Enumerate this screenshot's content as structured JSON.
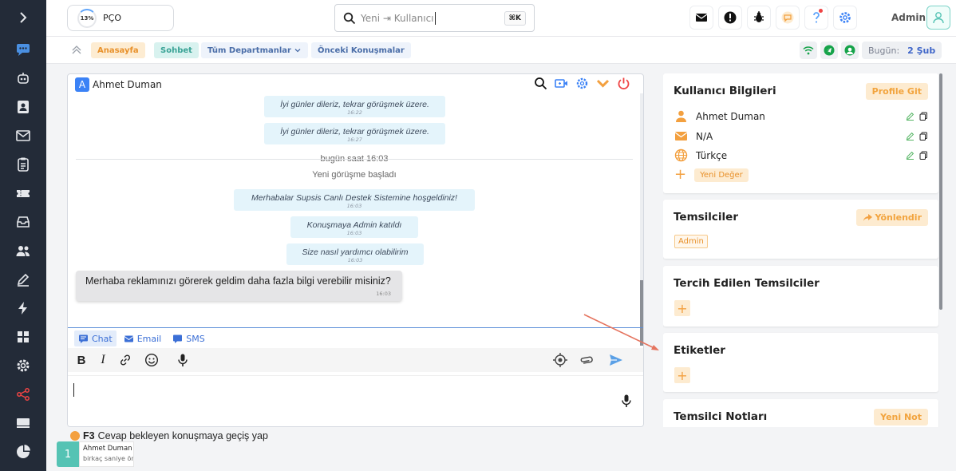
{
  "header": {
    "pco_percent": "13%",
    "pco_label": "PÇO",
    "search_placeholder": "Yeni ⇥ Kullanıcı",
    "shortcut": "⌘K",
    "admin_label": "Admin"
  },
  "sidebar": {
    "items": [
      "expand-icon",
      "chat-icon",
      "bot-icon",
      "contacts-icon",
      "mail-icon",
      "clipboard-icon",
      "ticket-icon",
      "inbox-icon",
      "users-icon",
      "edit-icon",
      "bolt-icon",
      "grid-icon",
      "settings-icon",
      "share-icon",
      "monitor-icon",
      "pie-icon"
    ]
  },
  "subbar": {
    "home": "Anasayfa",
    "chat": "Sohbet",
    "departments": "Tüm Departmanlar",
    "previous": "Önceki Konuşmalar",
    "today_label": "Bugün:",
    "today_value": "2 Şub"
  },
  "chat": {
    "contact_initial": "A",
    "contact_name": "Ahmet Duman",
    "messages": [
      {
        "text": "İyi günler dileriz, tekrar görüşmek üzere.",
        "time": "16:22"
      },
      {
        "text": "İyi günler dileriz, tekrar görüşmek üzere.",
        "time": "16:27"
      }
    ],
    "divider_text": "bugün saat 16:03",
    "session_text": "Yeni görüşme başladı",
    "system_messages": [
      {
        "text": "Merhabalar Supsis Canlı Destek Sistemine hoşgeldiniz!",
        "time": "16:03"
      },
      {
        "text": "Konuşmaya Admin katıldı",
        "time": "16:03"
      },
      {
        "text": "Size nasıl yardımcı olabilirim",
        "time": "16:03"
      }
    ],
    "incoming": {
      "text": "Merhaba reklamınızı görerek geldim daha fazla bilgi verebilir misiniz?",
      "time": "16:03"
    },
    "tabs": [
      "Chat",
      "Email",
      "SMS"
    ]
  },
  "footer": {
    "hint_key": "F3",
    "hint_text": "Cevap bekleyen konuşmaya geçiş yap",
    "queue_count": "1",
    "queue_name": "Ahmet Duman",
    "queue_time": "birkaç saniye önce"
  },
  "right": {
    "user_info": {
      "title": "Kullanıcı Bilgileri",
      "button": "Profile Git",
      "rows": [
        "Ahmet Duman",
        "N/A",
        "Türkçe"
      ],
      "add": "Yeni Değer"
    },
    "agents": {
      "title": "Temsilciler",
      "button": "Yönlendir",
      "tag": "Admin"
    },
    "preferred": {
      "title": "Tercih Edilen Temsilciler"
    },
    "tags": {
      "title": "Etiketler"
    },
    "notes": {
      "title": "Temsilci Notları",
      "button": "Yeni Not"
    }
  },
  "colors": {
    "sidebar": "#232b38",
    "accent_orange": "#f3a03f",
    "accent_blue": "#3b6fd6",
    "accent_teal": "#55c3b4"
  }
}
